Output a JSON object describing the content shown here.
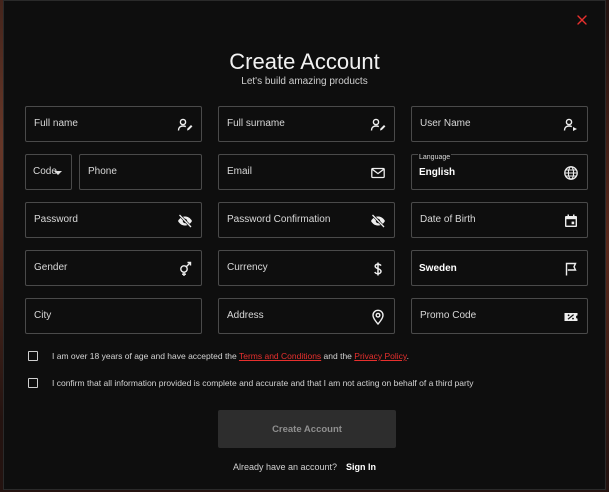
{
  "header": {
    "title": "Create Account",
    "subtitle": "Let's build amazing products"
  },
  "fields": {
    "full_name": "Full name",
    "full_surname": "Full surname",
    "user_name": "User Name",
    "code": "Code",
    "phone": "Phone",
    "email": "Email",
    "language_label": "Language",
    "language_value": "English",
    "password": "Password",
    "password_confirmation": "Password Confirmation",
    "date_of_birth": "Date of Birth",
    "gender": "Gender",
    "currency": "Currency",
    "country_value": "Sweden",
    "city": "City",
    "address": "Address",
    "promo_code": "Promo Code"
  },
  "terms": {
    "prefix": "I am over 18 years of age and have accepted the ",
    "terms_link": "Terms and Conditions",
    "middle": " and the ",
    "privacy_link": "Privacy Policy",
    "suffix": "."
  },
  "confirm": {
    "text": "I confirm that all information provided is complete and accurate and that I am not acting on behalf of a third party"
  },
  "actions": {
    "submit_label": "Create Account",
    "have_account": "Already have an account?",
    "sign_in": "Sign In"
  },
  "colors": {
    "accent": "#e8302e",
    "modal_bg": "#0e0e0e",
    "border": "#4a4a4a"
  }
}
